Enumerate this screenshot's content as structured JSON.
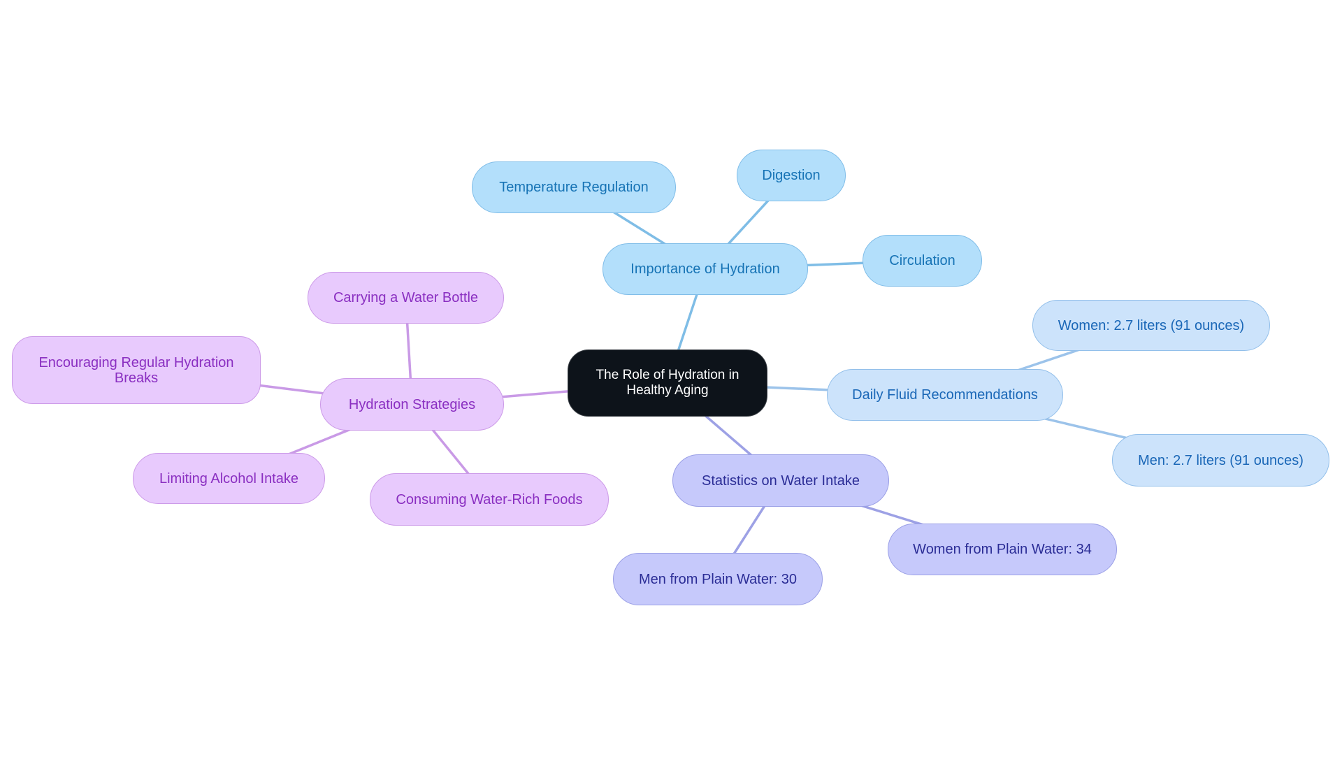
{
  "title": "The Role of Hydration in Healthy Aging",
  "colors": {
    "root_fill": "#0d131a",
    "importance_branch": "#b3dffb",
    "importance_edge": "#7fbde6",
    "fluid_branch": "#cce3fb",
    "fluid_edge": "#9cc3ea",
    "statistics_branch": "#c6c9fb",
    "statistics_edge": "#9da1e5",
    "strategies_branch": "#e8cafd",
    "strategies_edge": "#c99ae6"
  },
  "nodes": {
    "root": {
      "label_line1": "The Role of Hydration in",
      "label_line2": "Healthy Aging"
    },
    "importance": {
      "label": "Importance of Hydration"
    },
    "temperature": {
      "label": "Temperature Regulation"
    },
    "digestion": {
      "label": "Digestion"
    },
    "circulation": {
      "label": "Circulation"
    },
    "fluid": {
      "label": "Daily Fluid Recommendations"
    },
    "fluid_women": {
      "label": "Women: 2.7 liters (91 ounces)"
    },
    "fluid_men": {
      "label": "Men: 2.7 liters (91 ounces)"
    },
    "statistics": {
      "label": "Statistics on Water Intake"
    },
    "stats_women": {
      "label": "Women from Plain Water: 34"
    },
    "stats_men": {
      "label": "Men from Plain Water: 30"
    },
    "strategies": {
      "label": "Hydration Strategies"
    },
    "carrying": {
      "label": "Carrying a Water Bottle"
    },
    "encouraging": {
      "label_line1": "Encouraging Regular Hydration",
      "label_line2": "Breaks"
    },
    "limiting": {
      "label": "Limiting Alcohol Intake"
    },
    "consuming": {
      "label": "Consuming Water-Rich Foods"
    }
  },
  "edges": [
    {
      "from": "root",
      "to": "importance",
      "branch": "importance"
    },
    {
      "from": "importance",
      "to": "temperature",
      "branch": "importance"
    },
    {
      "from": "importance",
      "to": "digestion",
      "branch": "importance"
    },
    {
      "from": "importance",
      "to": "circulation",
      "branch": "importance"
    },
    {
      "from": "root",
      "to": "fluid",
      "branch": "fluid"
    },
    {
      "from": "fluid",
      "to": "fluid_women",
      "branch": "fluid"
    },
    {
      "from": "fluid",
      "to": "fluid_men",
      "branch": "fluid"
    },
    {
      "from": "root",
      "to": "statistics",
      "branch": "statistics"
    },
    {
      "from": "statistics",
      "to": "stats_women",
      "branch": "statistics"
    },
    {
      "from": "statistics",
      "to": "stats_men",
      "branch": "statistics"
    },
    {
      "from": "root",
      "to": "strategies",
      "branch": "strategies"
    },
    {
      "from": "strategies",
      "to": "carrying",
      "branch": "strategies"
    },
    {
      "from": "strategies",
      "to": "encouraging",
      "branch": "strategies"
    },
    {
      "from": "strategies",
      "to": "limiting",
      "branch": "strategies"
    },
    {
      "from": "strategies",
      "to": "consuming",
      "branch": "strategies"
    }
  ]
}
